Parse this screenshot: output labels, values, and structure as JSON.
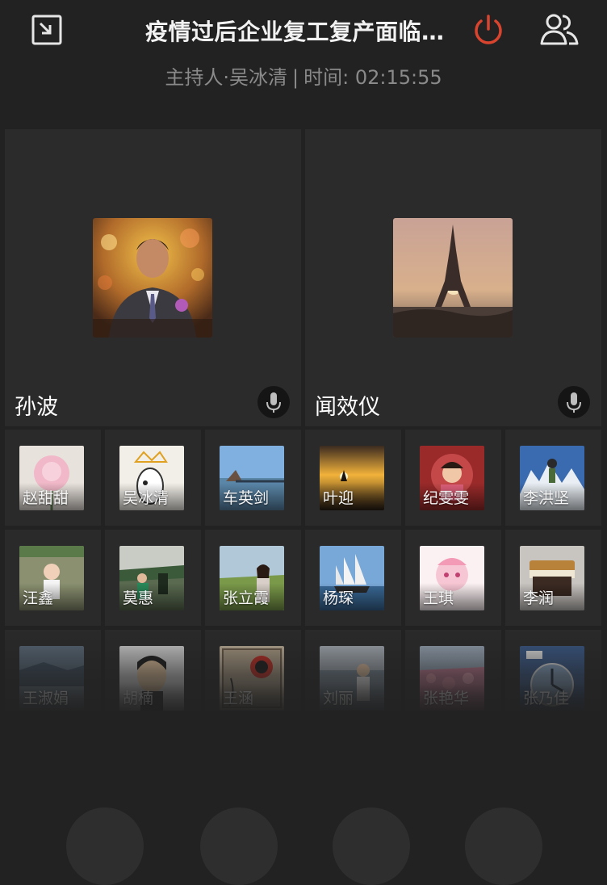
{
  "header": {
    "title": "疫情过后企业复工复产面临…",
    "host_label": "主持人·吴冰清",
    "separator": "|",
    "time_label": "时间: 02:15:55"
  },
  "speakers": [
    {
      "name": "孙波",
      "icon": "microphone-icon"
    },
    {
      "name": "闻效仪",
      "icon": "microphone-icon"
    }
  ],
  "participants": [
    "赵甜甜",
    "吴冰清",
    "车英剑",
    "叶迎",
    "纪雯雯",
    "李洪坚",
    "汪鑫",
    "莫惠",
    "张立霞",
    "杨琛",
    "王琪",
    "李润",
    "王淑娟",
    "胡楠",
    "王涵",
    "刘丽",
    "张艳华",
    "张乃佳"
  ],
  "colors": {
    "background": "#222222",
    "panel": "#2a2a2a",
    "power_accent": "#d9442f",
    "subtitle": "#8a8a8a"
  }
}
